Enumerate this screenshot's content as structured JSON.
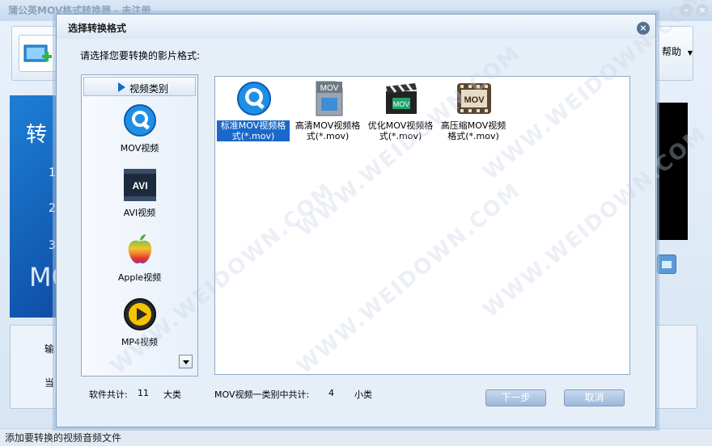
{
  "main": {
    "title": "蒲公英MOV格式转换器 - 未注册",
    "help_label": "帮助",
    "banner_big": "转",
    "banner_nums": [
      "1",
      "2",
      "3"
    ],
    "banner_logo": "MC",
    "bottom_labels": [
      "输",
      "当"
    ],
    "status_text": "添加要转换的视频音频文件"
  },
  "dialog": {
    "title": "选择转换格式",
    "prompt": "请选择您要转换的影片格式:",
    "category_header": "视频类别",
    "categories": [
      {
        "label": "MOV视频",
        "icon": "quicktime-icon"
      },
      {
        "label": "AVI视频",
        "icon": "avi-icon"
      },
      {
        "label": "Apple视频",
        "icon": "apple-icon"
      },
      {
        "label": "MP4视频",
        "icon": "mp4-play-icon"
      }
    ],
    "formats": [
      {
        "label": "标准MOV视频格式(*.mov)",
        "icon": "quicktime-icon",
        "selected": true
      },
      {
        "label": "高清MOV视频格式(*.mov)",
        "icon": "mov-file-icon",
        "selected": false
      },
      {
        "label": "优化MOV视频格式(*.mov)",
        "icon": "clapperboard-icon",
        "selected": false
      },
      {
        "label": "高压缩MOV视频格式(*.mov)",
        "icon": "mov-film-icon",
        "selected": false
      }
    ],
    "info": {
      "software_total_label": "软件共计:",
      "software_total_value": "11",
      "software_total_unit": "大类",
      "category_total_label": "MOV视频一类别中共计:",
      "category_total_value": "4",
      "category_total_unit": "小类"
    },
    "next_button": "下一步",
    "cancel_button": "取消"
  },
  "watermark": "WWW.WEIDOWN.COM"
}
